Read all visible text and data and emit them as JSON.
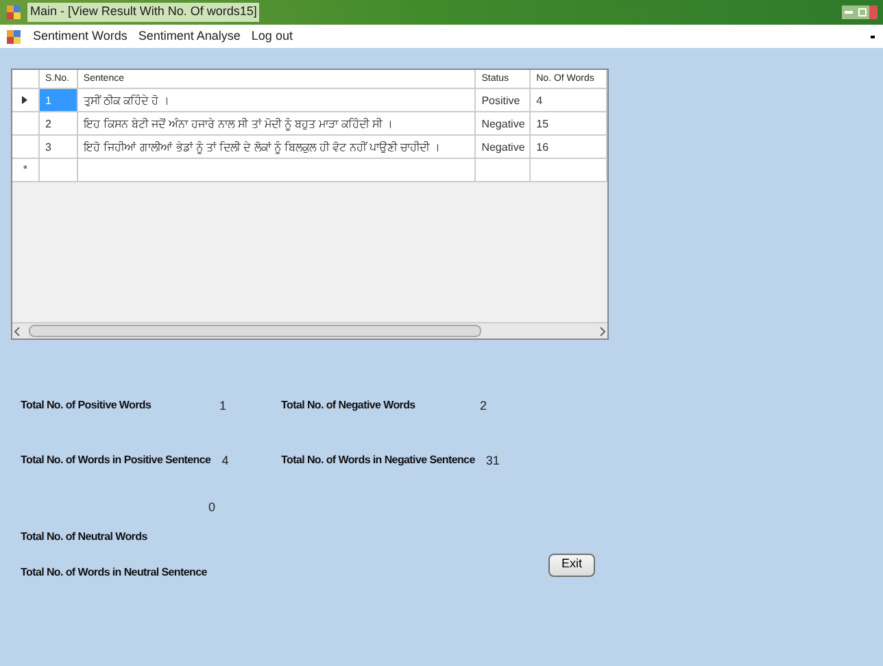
{
  "window": {
    "title": "Main - [View Result With No. Of words15]"
  },
  "menu": [
    "Sentiment Words",
    "Sentiment Analyse",
    "Log out"
  ],
  "table": {
    "columns": [
      "S.No.",
      "Sentence",
      "Status",
      "No. Of Words"
    ],
    "rows": [
      {
        "cells": [
          "1",
          "ਤੁਸੀਂ ਠੀਕ ਕਹਿੰਦੇ ਹੋ ।",
          "Positive",
          "4"
        ],
        "selected": true
      },
      {
        "cells": [
          "2",
          "ਇਹ ਕਿਸਨ ਬੇਟੀ ਜਦੋਂ ਅੰਨਾ ਹਜਾਰੇ ਨਾਲ ਸੀ ਤਾਂ ਮੋਦੀ ਨੂੰ ਬਹੁਤ ਮਾੜਾ ਕਹਿੰਦੀ ਸੀ ।",
          "Negative",
          "15"
        ],
        "selected": false
      },
      {
        "cells": [
          "3",
          "ਇਹੋ ਜਿਹੀਆਂ ਗਾਲੀਆਂ ਭੇਡਾਂ ਨੂੰ ਤਾਂ ਦਿਲੀ ਦੇ ਲੋਕਾਂ ਨੂੰ ਬਿਲਕੁਲ ਹੀ ਵੋਟ ਨਹੀਂ ਪਾਉਣੀ ਚਾਹੀਦੀ ।",
          "Negative",
          "16"
        ],
        "selected": false
      }
    ],
    "new_row_marker": "*"
  },
  "stats": [
    {
      "label": "Total No. of Positive Words",
      "value": "1"
    },
    {
      "label": "Total No. of Negative Words",
      "value": "2"
    },
    {
      "label": "Total No. of Words in Positive Sentence",
      "value": "4"
    },
    {
      "label": "Total No. of Words in Negative Sentence",
      "value": "31"
    },
    {
      "label": "Total No. of Neutral Words",
      "value": "0"
    },
    {
      "label": "Total No. of Words in Neutral Sentence"
    }
  ],
  "exit_button": "Exit"
}
